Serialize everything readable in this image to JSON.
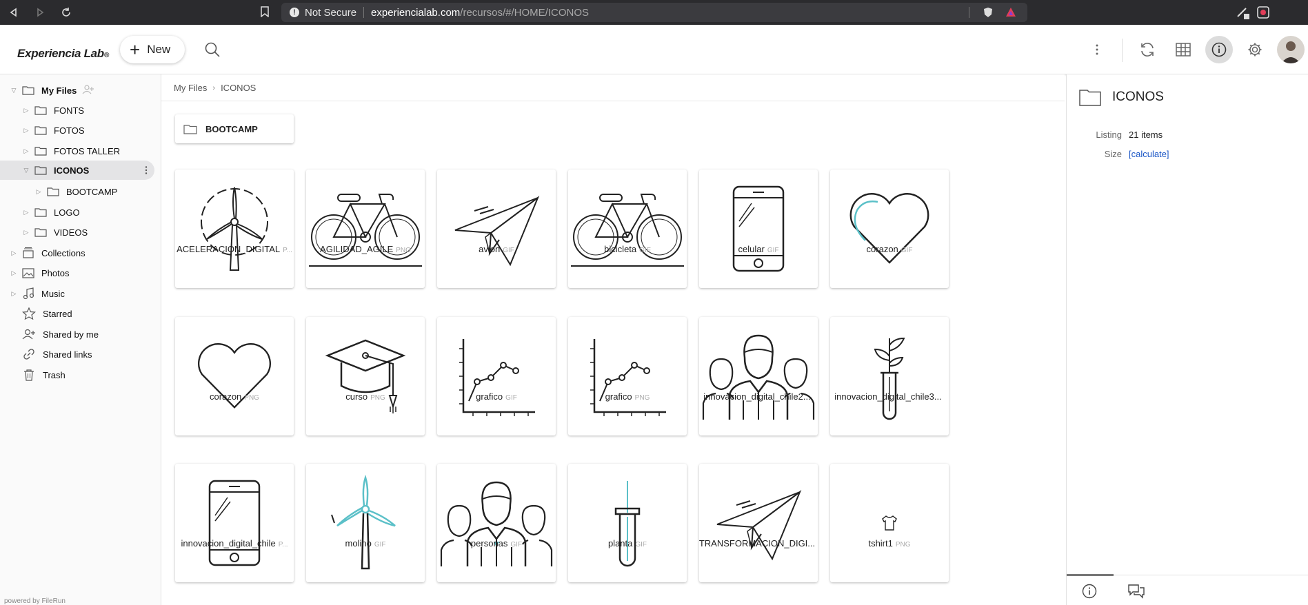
{
  "browser": {
    "security_label": "Not Secure",
    "url_host": "experiencialab.com",
    "url_path": "/recursos/#/HOME/ICONOS"
  },
  "header": {
    "logo": "Experiencia Lab",
    "new_label": "New"
  },
  "sidebar": {
    "items": [
      {
        "label": "My Files"
      },
      {
        "label": "FONTS"
      },
      {
        "label": "FOTOS"
      },
      {
        "label": "FOTOS TALLER"
      },
      {
        "label": "ICONOS"
      },
      {
        "label": "BOOTCAMP"
      },
      {
        "label": "LOGO"
      },
      {
        "label": "VIDEOS"
      },
      {
        "label": "Collections"
      },
      {
        "label": "Photos"
      },
      {
        "label": "Music"
      },
      {
        "label": "Starred"
      },
      {
        "label": "Shared by me"
      },
      {
        "label": "Shared links"
      },
      {
        "label": "Trash"
      }
    ],
    "powered": "powered by FileRun"
  },
  "breadcrumb": {
    "root": "My Files",
    "current": "ICONOS"
  },
  "folders": [
    {
      "name": "BOOTCAMP"
    }
  ],
  "files": [
    {
      "name": "ACELERACION_DIGITAL",
      "ext": "P...",
      "icon": "wind-turbine-circle-icon"
    },
    {
      "name": "AGILIDAD_AGILE",
      "ext": "PNG",
      "icon": "bicycle-icon"
    },
    {
      "name": "avion",
      "ext": "GIF",
      "icon": "paper-plane-icon"
    },
    {
      "name": "bicicleta",
      "ext": "GIF",
      "icon": "bicycle-icon"
    },
    {
      "name": "celular",
      "ext": "GIF",
      "icon": "smartphone-icon"
    },
    {
      "name": "corazon",
      "ext": "GIF",
      "icon": "heart-icon"
    },
    {
      "name": "corazon",
      "ext": "PNG",
      "icon": "heart-icon"
    },
    {
      "name": "curso",
      "ext": "PNG",
      "icon": "graduation-cap-icon"
    },
    {
      "name": "grafico",
      "ext": "GIF",
      "icon": "line-chart-icon"
    },
    {
      "name": "grafico",
      "ext": "PNG",
      "icon": "line-chart-icon"
    },
    {
      "name": "innovacion_digital_chile2...",
      "ext": "",
      "icon": "people-group-icon"
    },
    {
      "name": "innovacion_digital_chile3...",
      "ext": "",
      "icon": "plant-tube-icon"
    },
    {
      "name": "innovacion_digital_chile",
      "ext": "P...",
      "icon": "smartphone-icon"
    },
    {
      "name": "molino",
      "ext": "GIF",
      "icon": "wind-turbine-icon"
    },
    {
      "name": "personas",
      "ext": "GIF",
      "icon": "people-group-icon"
    },
    {
      "name": "planta",
      "ext": "GIF",
      "icon": "test-tube-icon"
    },
    {
      "name": "TRANSFORMACION_DIGI...",
      "ext": "",
      "icon": "paper-plane-icon"
    },
    {
      "name": "tshirt1",
      "ext": "PNG",
      "icon": "tshirt-icon"
    }
  ],
  "info": {
    "title": "ICONOS",
    "listing_label": "Listing",
    "listing_value": "21 items",
    "size_label": "Size",
    "size_value": "[calculate]"
  },
  "colors": {
    "accent_teal": "#5bc0c8",
    "link": "#1a56c6"
  }
}
